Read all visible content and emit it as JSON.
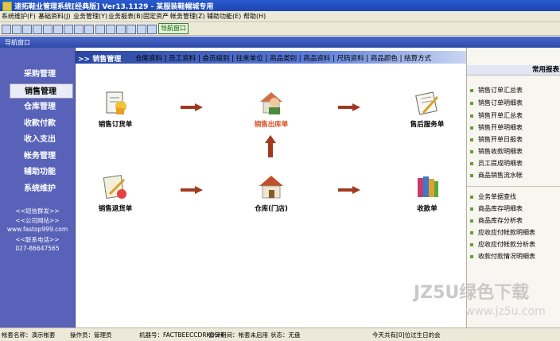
{
  "window": {
    "title": "速拓鞋业管理系统[经典版] Ver13.1129 - 某服装鞋帽城专用"
  },
  "menu": [
    "系统维护(F)",
    "基础资料(J)",
    "业务管理(Y)",
    "业务报表(B)",
    "固定资产",
    "帐务管理(Z)",
    "辅助功能(E)",
    "帮助(H)"
  ],
  "toolbar": {
    "nav_button": "导航窗口"
  },
  "nav_window": {
    "title": "导航窗口"
  },
  "sidebar": {
    "items": [
      "采购管理",
      "销售管理",
      "仓库管理",
      "收款付款",
      "收入支出",
      "帐务管理",
      "辅助功能",
      "系统维护"
    ],
    "active_index": 1,
    "info": [
      "<<短信群发>>",
      "<<公司网站>>",
      "www.fastop999.com",
      "<<联系电话>>",
      "027-86647565"
    ]
  },
  "main": {
    "current_section": ">> 销售管理",
    "tabs": "仓库资料 | 员工资料 | 会员级别 | 往来单位 | 商品类别 | 商品资料 | 尺码资料 | 商品颜色 | 结算方式",
    "nodes": {
      "sales_order": "销售订货单",
      "sales_outbound": "销售出库单",
      "after_sales": "售后服务单",
      "sales_return": "销售退货单",
      "warehouse": "仓库(门店)",
      "receipt": "收款单"
    }
  },
  "right_panel": {
    "title": "常用报表",
    "group1": [
      "销售订单汇总表",
      "销售订单明细表",
      "销售开单汇总表",
      "销售开单明细表",
      "销售开单日报表",
      "销售收款明细表",
      "员工提成明细表",
      "商品销售流水帐"
    ],
    "group2": [
      "业务单据查找",
      "商品库存明细表",
      "商品库存分析表",
      "应收应付帐款明细表",
      "应收应付帐款分析表",
      "收款付款情况明细表"
    ]
  },
  "watermark": {
    "line1": "JZ5U绿色下载",
    "line2": "www.jz5u.com"
  },
  "status": {
    "account": "帐套名称：演示帐套",
    "operator": "操作员：管理员",
    "machine": "机器号：FACTBEECCDRKOSH",
    "period": "会计期间：帐套未启用",
    "state": "状态：无盘",
    "message": "今天共有[0]位过生日的会"
  },
  "colors": {
    "sidebar": "#5862b8",
    "title_bar": "#1c45b0",
    "arrow": "#a03a1e",
    "highlight_label": "#d94a1a"
  }
}
